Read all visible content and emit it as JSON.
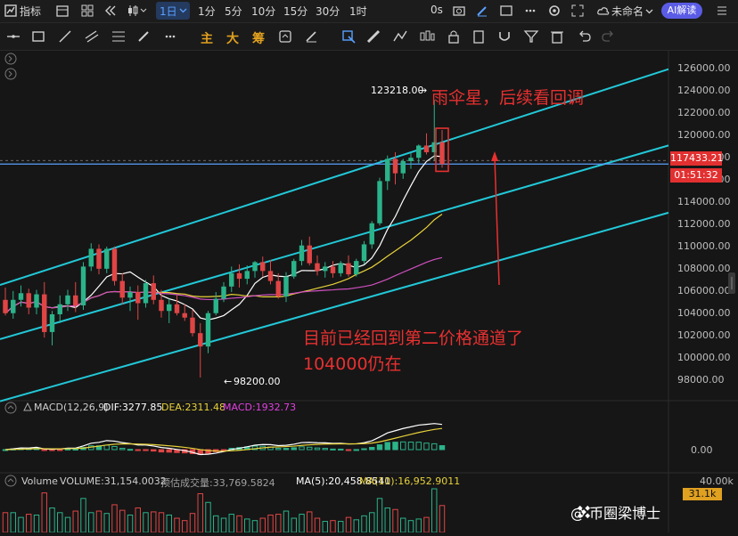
{
  "topbar": {
    "indicators_label": "指标",
    "intervals": [
      "1分",
      "5分",
      "10分",
      "15分",
      "30分",
      "1时"
    ],
    "selected_interval": "1日",
    "replay_time": "0s",
    "layout_name": "未命名",
    "ai_label": "AI解读"
  },
  "toolbar": {
    "labels": [
      "主",
      "大",
      "筹"
    ]
  },
  "annotations": {
    "umbrella": "雨伞星，后续看回调",
    "channel": "目前已经回到第二价格通道了",
    "level": "104000仍在",
    "high_label": "123218.00",
    "low_label": "98200.00"
  },
  "price_axis": {
    "ticks": [
      "126000.00",
      "124000.00",
      "122000.00",
      "120000.00",
      "118000.00",
      "116000.00",
      "114000.00",
      "112000.00",
      "110000.00",
      "108000.00",
      "106000.00",
      "104000.00",
      "102000.00",
      "100000.00",
      "98000.00"
    ],
    "current_price": "117433.21",
    "countdown": "01:51:32"
  },
  "macd": {
    "name": "MACD(12,26,9)",
    "dif": "DIF:3277.85",
    "dea": "DEA:2311.48",
    "macd": "MACD:1932.73",
    "zero": "0.00",
    "colors": {
      "dif": "#ffffff",
      "dea": "#e8d23a",
      "macd": "#e040e0"
    }
  },
  "volume": {
    "name": "Volume",
    "volume": "VOLUME:31,154.0032",
    "estimate": "预估成交量:33,769.5824",
    "ma5": "MA(5):20,458.8541",
    "ma10": "MA(10):16,952.9011",
    "axis_top": "40.00k",
    "current": "31.1k"
  },
  "watermark": "@ 币圈梁博士",
  "colors": {
    "up": "#2bb38a",
    "down": "#e04545",
    "channel": "#22c8d8",
    "accent": "#5aa0ff"
  },
  "chart_data": {
    "type": "candlestick",
    "x": [
      1,
      2,
      3,
      4,
      5,
      6,
      7,
      8,
      9,
      10,
      11,
      12,
      13,
      14,
      15,
      16,
      17,
      18,
      19,
      20,
      21,
      22,
      23,
      24,
      25,
      26,
      27,
      28,
      29,
      30,
      31,
      32,
      33,
      34,
      35,
      36,
      37,
      38,
      39,
      40,
      41,
      42,
      43,
      44,
      45,
      46,
      47,
      48,
      49,
      50,
      51,
      52,
      53,
      54,
      55,
      56,
      57,
      58,
      59,
      60,
      61,
      62
    ],
    "ohlc": [
      [
        105200,
        106300,
        103800,
        104000
      ],
      [
        104000,
        106000,
        103500,
        105200
      ],
      [
        105200,
        106500,
        104600,
        105800
      ],
      [
        105800,
        106200,
        103900,
        104500
      ],
      [
        104500,
        106100,
        103900,
        105700
      ],
      [
        105700,
        106800,
        101800,
        102300
      ],
      [
        102300,
        104200,
        101100,
        103900
      ],
      [
        103900,
        105600,
        103100,
        104800
      ],
      [
        104800,
        106100,
        104200,
        105600
      ],
      [
        105600,
        106800,
        104100,
        104700
      ],
      [
        104700,
        108600,
        104300,
        108200
      ],
      [
        108200,
        110300,
        107800,
        109800
      ],
      [
        109800,
        110200,
        107500,
        108000
      ],
      [
        108000,
        110000,
        107600,
        109800
      ],
      [
        109800,
        110000,
        106500,
        106900
      ],
      [
        106900,
        107600,
        104800,
        105400
      ],
      [
        105400,
        106400,
        104200,
        105900
      ],
      [
        105900,
        106500,
        103400,
        104900
      ],
      [
        104900,
        107000,
        104500,
        106700
      ],
      [
        106700,
        107400,
        104800,
        105200
      ],
      [
        105200,
        106100,
        103600,
        104200
      ],
      [
        104200,
        105300,
        103100,
        104800
      ],
      [
        104800,
        105600,
        103800,
        104000
      ],
      [
        104000,
        104800,
        103300,
        103600
      ],
      [
        103600,
        104300,
        101900,
        102200
      ],
      [
        102200,
        103100,
        98200,
        101000
      ],
      [
        101000,
        104200,
        100400,
        104000
      ],
      [
        104000,
        105900,
        103800,
        105300
      ],
      [
        105300,
        106800,
        105000,
        106400
      ],
      [
        106400,
        108200,
        105900,
        107600
      ],
      [
        107600,
        108400,
        106300,
        107100
      ],
      [
        107100,
        108300,
        106600,
        107800
      ],
      [
        107800,
        108700,
        107200,
        108600
      ],
      [
        108600,
        109100,
        107300,
        107800
      ],
      [
        107800,
        108800,
        106600,
        106900
      ],
      [
        106900,
        107600,
        105300,
        105500
      ],
      [
        105500,
        107700,
        105000,
        107300
      ],
      [
        107300,
        108900,
        107100,
        108700
      ],
      [
        108700,
        110600,
        108300,
        110100
      ],
      [
        110100,
        110900,
        108300,
        108500
      ],
      [
        108500,
        109200,
        107400,
        107800
      ],
      [
        107800,
        108600,
        107200,
        108200
      ],
      [
        108200,
        108700,
        107200,
        107600
      ],
      [
        107600,
        108700,
        107300,
        108500
      ],
      [
        108500,
        109200,
        107300,
        107500
      ],
      [
        107500,
        108900,
        107300,
        108700
      ],
      [
        108700,
        110500,
        108400,
        110200
      ],
      [
        110200,
        112300,
        109800,
        112100
      ],
      [
        112100,
        116200,
        111900,
        115900
      ],
      [
        115900,
        118200,
        115100,
        117900
      ],
      [
        117900,
        118500,
        115600,
        116600
      ],
      [
        116600,
        117900,
        116100,
        117700
      ],
      [
        117700,
        118500,
        117000,
        118000
      ],
      [
        118000,
        119200,
        117500,
        119100
      ],
      [
        119100,
        120200,
        118300,
        118500
      ],
      [
        118500,
        123218,
        117700,
        119400
      ],
      [
        119400,
        120500,
        117100,
        117433
      ]
    ],
    "ylim": [
      97000,
      127000
    ],
    "price_marks": {
      "high": 123218,
      "low": 98200,
      "current": 117433.21
    },
    "macd": {
      "dif": 3277.85,
      "dea": 2311.48,
      "macd": 1932.73
    },
    "volume": {
      "volume": 31154.0032,
      "estimate": 33769.5824,
      "ma5": 20458.8541,
      "ma10": 16952.9011
    }
  }
}
